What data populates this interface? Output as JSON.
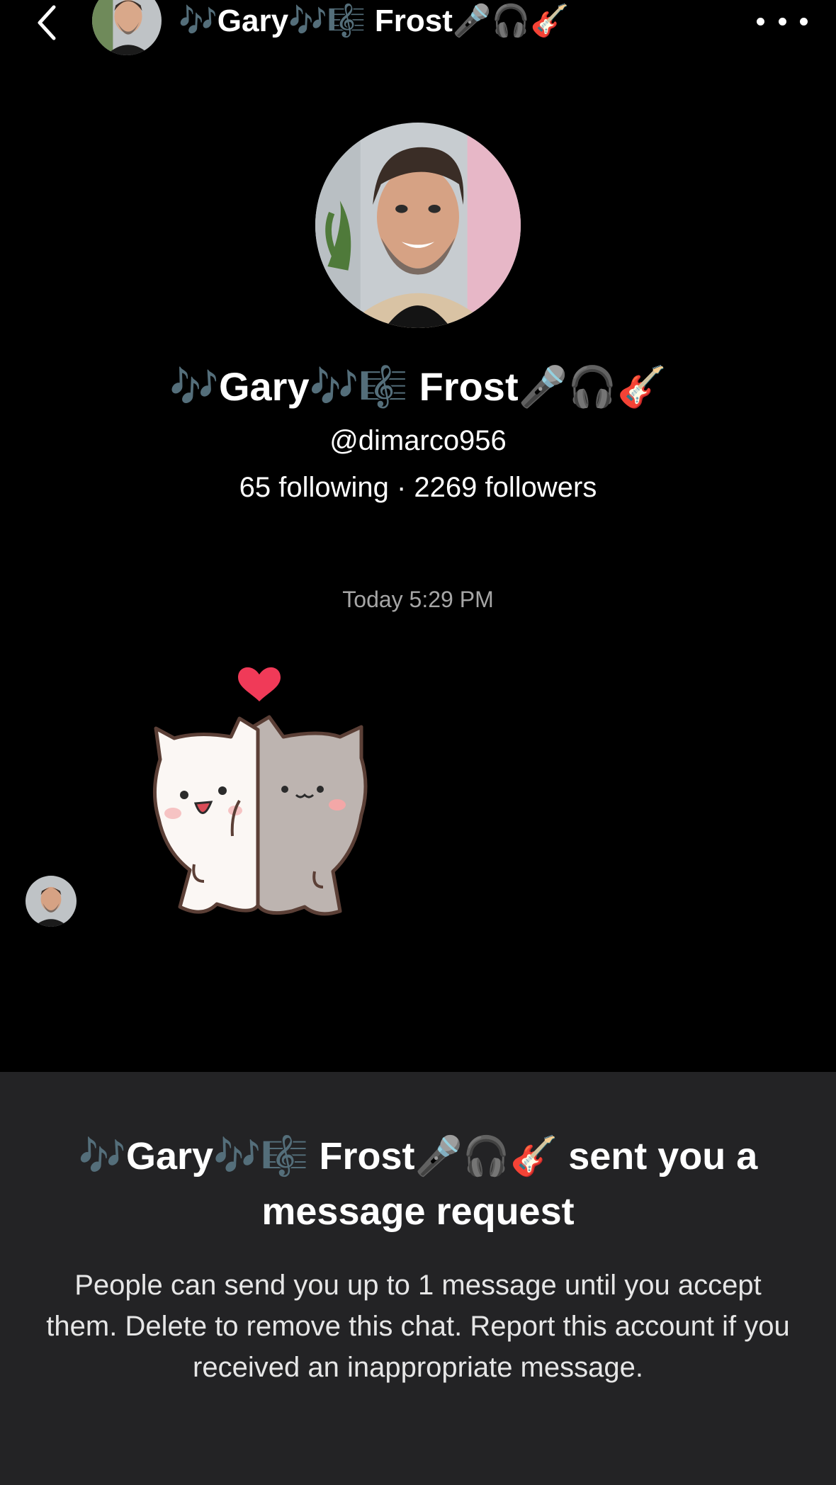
{
  "header": {
    "title": "🎶Gary🎶🎼 Frost🎤🎧🎸",
    "back_icon": "chevron-left-icon",
    "more_icon": "more-horizontal-icon"
  },
  "profile": {
    "display_name": "🎶Gary🎶🎼 Frost🎤🎧🎸",
    "handle": "@dimarco956",
    "stats": "65 following · 2269 followers"
  },
  "conversation": {
    "timestamp": "Today 5:29 PM",
    "sticker": "hugging-cats-sticker"
  },
  "request": {
    "title": "🎶Gary🎶🎼 Frost🎤🎧🎸 sent you a message request",
    "body": "People can send you up to 1 message until you accept them. Delete to remove this chat. Report this account if you received an inappropriate message."
  },
  "colors": {
    "background": "#000000",
    "panel": "#232325",
    "muted_text": "#a6a6a6",
    "heart": "#f03a58"
  }
}
